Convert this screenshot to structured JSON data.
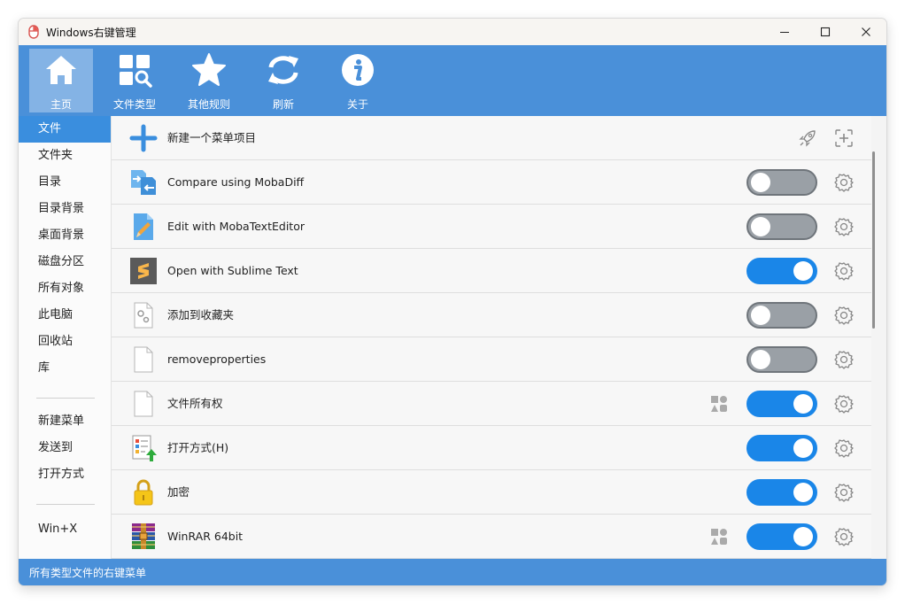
{
  "window": {
    "title": "Windows右键管理"
  },
  "toolbar": {
    "items": [
      {
        "label": "主页",
        "icon": "home-icon",
        "active": true
      },
      {
        "label": "文件类型",
        "icon": "file-types-icon",
        "active": false
      },
      {
        "label": "其他规则",
        "icon": "star-icon",
        "active": false
      },
      {
        "label": "刷新",
        "icon": "refresh-icon",
        "active": false
      },
      {
        "label": "关于",
        "icon": "info-icon",
        "active": false
      }
    ]
  },
  "sidebar": {
    "items": [
      "文件",
      "文件夹",
      "目录",
      "目录背景",
      "桌面背景",
      "磁盘分区",
      "所有对象",
      "此电脑",
      "回收站",
      "库"
    ],
    "items2": [
      "新建菜单",
      "发送到",
      "打开方式"
    ],
    "items3": [
      "Win+X"
    ],
    "active": "文件"
  },
  "new_item": {
    "label": "新建一个菜单项目"
  },
  "menu_items": [
    {
      "label": "Compare using MobaDiff",
      "icon": "mobadiff-icon",
      "enabled": false,
      "shapes": false
    },
    {
      "label": "Edit with MobaTextEditor",
      "icon": "mobatexteditor-icon",
      "enabled": false,
      "shapes": false
    },
    {
      "label": "Open with Sublime Text",
      "icon": "sublime-icon",
      "enabled": true,
      "shapes": false
    },
    {
      "label": "添加到收藏夹",
      "icon": "favorites-file-icon",
      "enabled": false,
      "shapes": false
    },
    {
      "label": "removeproperties",
      "icon": "blank-file-icon",
      "enabled": false,
      "shapes": false
    },
    {
      "label": "文件所有权",
      "icon": "blank-file-icon",
      "enabled": true,
      "shapes": true
    },
    {
      "label": "打开方式(H)",
      "icon": "open-with-icon",
      "enabled": true,
      "shapes": false
    },
    {
      "label": "加密",
      "icon": "lock-icon",
      "enabled": true,
      "shapes": false
    },
    {
      "label": "WinRAR 64bit",
      "icon": "winrar-icon",
      "enabled": true,
      "shapes": true
    }
  ],
  "status": {
    "text": "所有类型文件的右键菜单"
  },
  "colors": {
    "accent": "#4a90d9",
    "toggle_on": "#1a86e8",
    "toggle_off": "#9aa0a6"
  }
}
